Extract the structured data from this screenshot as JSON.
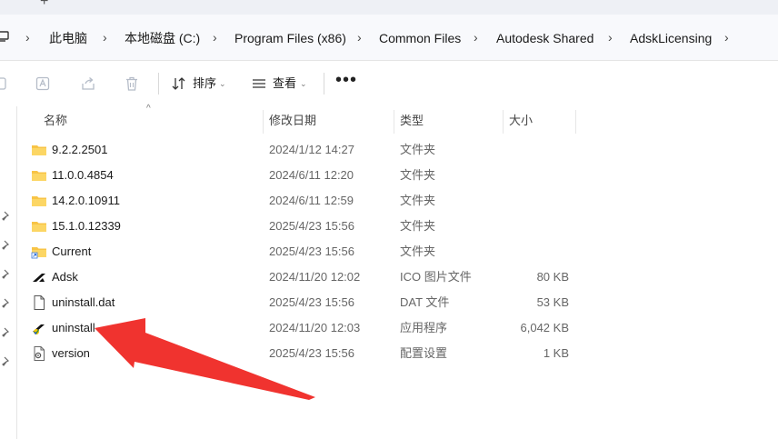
{
  "tabstrip": {
    "new_tab": "+"
  },
  "breadcrumb": [
    {
      "label": "此电脑"
    },
    {
      "label": "本地磁盘 (C:)"
    },
    {
      "label": "Program Files (x86)"
    },
    {
      "label": "Common Files"
    },
    {
      "label": "Autodesk Shared"
    },
    {
      "label": "AdskLicensing"
    }
  ],
  "toolbar": {
    "sort_label": "排序",
    "view_label": "查看",
    "more_label": "•••"
  },
  "columns": {
    "name": "名称",
    "date": "修改日期",
    "type": "类型",
    "size": "大小"
  },
  "files": [
    {
      "name": "9.2.2.2501",
      "date": "2024/1/12 14:27",
      "type": "文件夹",
      "size": "",
      "icon": "folder-icon"
    },
    {
      "name": "11.0.0.4854",
      "date": "2024/6/11 12:20",
      "type": "文件夹",
      "size": "",
      "icon": "folder-icon"
    },
    {
      "name": "14.2.0.10911",
      "date": "2024/6/11 12:59",
      "type": "文件夹",
      "size": "",
      "icon": "folder-icon"
    },
    {
      "name": "15.1.0.12339",
      "date": "2025/4/23 15:56",
      "type": "文件夹",
      "size": "",
      "icon": "folder-icon"
    },
    {
      "name": "Current",
      "date": "2025/4/23 15:56",
      "type": "文件夹",
      "size": "",
      "icon": "folder-shortcut-icon"
    },
    {
      "name": "Adsk",
      "date": "2024/11/20 12:02",
      "type": "ICO 图片文件",
      "size": "80 KB",
      "icon": "autodesk-logo-icon"
    },
    {
      "name": "uninstall.dat",
      "date": "2025/4/23 15:56",
      "type": "DAT 文件",
      "size": "53 KB",
      "icon": "file-icon"
    },
    {
      "name": "uninstall",
      "date": "2024/11/20 12:03",
      "type": "应用程序",
      "size": "6,042 KB",
      "icon": "app-icon"
    },
    {
      "name": "version",
      "date": "2025/4/23 15:56",
      "type": "配置设置",
      "size": "1 KB",
      "icon": "config-file-icon"
    }
  ],
  "colors": {
    "folder": "#f8c446",
    "arrow": "#f0332f",
    "accent": "#1a1a1a"
  }
}
